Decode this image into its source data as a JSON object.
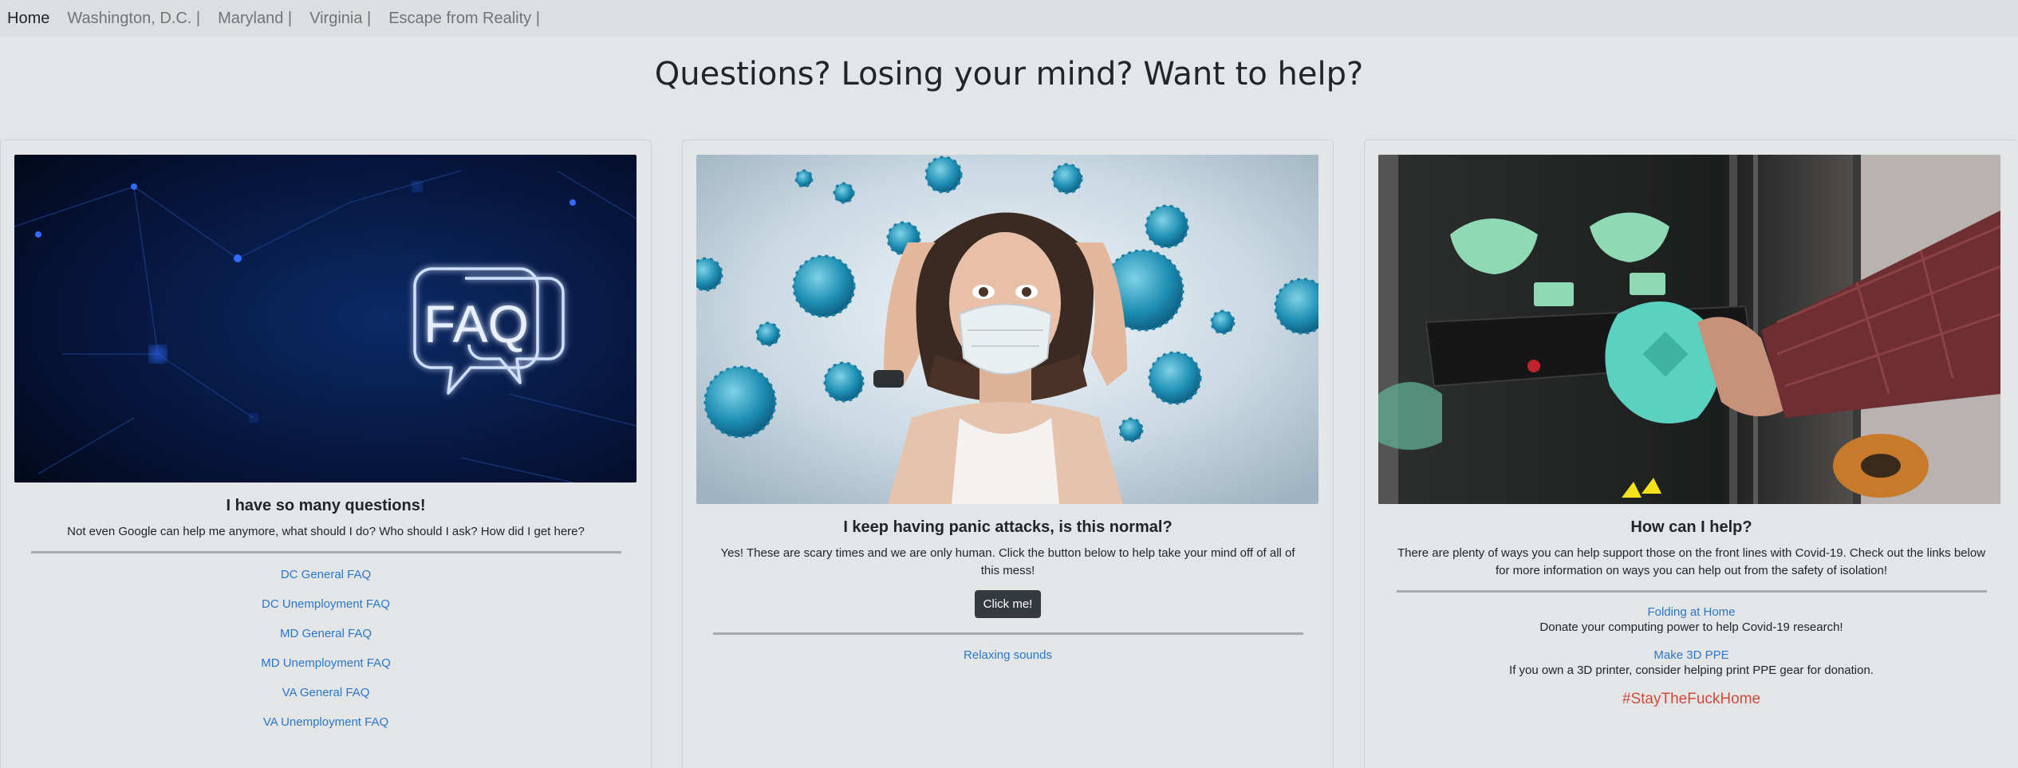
{
  "nav": {
    "items": [
      {
        "label": "Home",
        "active": true
      },
      {
        "label": "Washington, D.C. |"
      },
      {
        "label": "Maryland |"
      },
      {
        "label": "Virginia |"
      },
      {
        "label": "Escape from Reality |"
      }
    ]
  },
  "page_title": "Questions? Losing your mind? Want to help?",
  "cards": [
    {
      "image_text": "FAQ",
      "title": "I have so many questions!",
      "text": "Not even Google can help me anymore, what should I do? Who should I ask? How did I get here?",
      "links": [
        "DC General FAQ",
        "DC Unemployment FAQ",
        "MD General FAQ",
        "MD Unemployment FAQ",
        "VA General FAQ",
        "VA Unemployment FAQ"
      ]
    },
    {
      "title": "I keep having panic attacks, is this normal?",
      "text": "Yes! These are scary times and we are only human. Click the button below to help take your mind off of all of this mess!",
      "button": "Click me!",
      "links": [
        "Relaxing sounds"
      ]
    },
    {
      "title": "How can I help?",
      "text": "There are plenty of ways you can help support those on the front lines with Covid-19. Check out the links below for more information on ways you can help out from the safety of isolation!",
      "items": [
        {
          "link": "Folding at Home",
          "desc": "Donate your computing power to help Covid-19 research!"
        },
        {
          "link": "Make 3D PPE",
          "desc": "If you own a 3D printer, consider helping print PPE gear for donation."
        }
      ],
      "hashtag": "#StayTheFuckHome"
    }
  ],
  "colors": {
    "link": "#2a77c9",
    "hashtag": "#d04a3a",
    "button_bg": "#343a40",
    "background": "#e4e5e6"
  }
}
